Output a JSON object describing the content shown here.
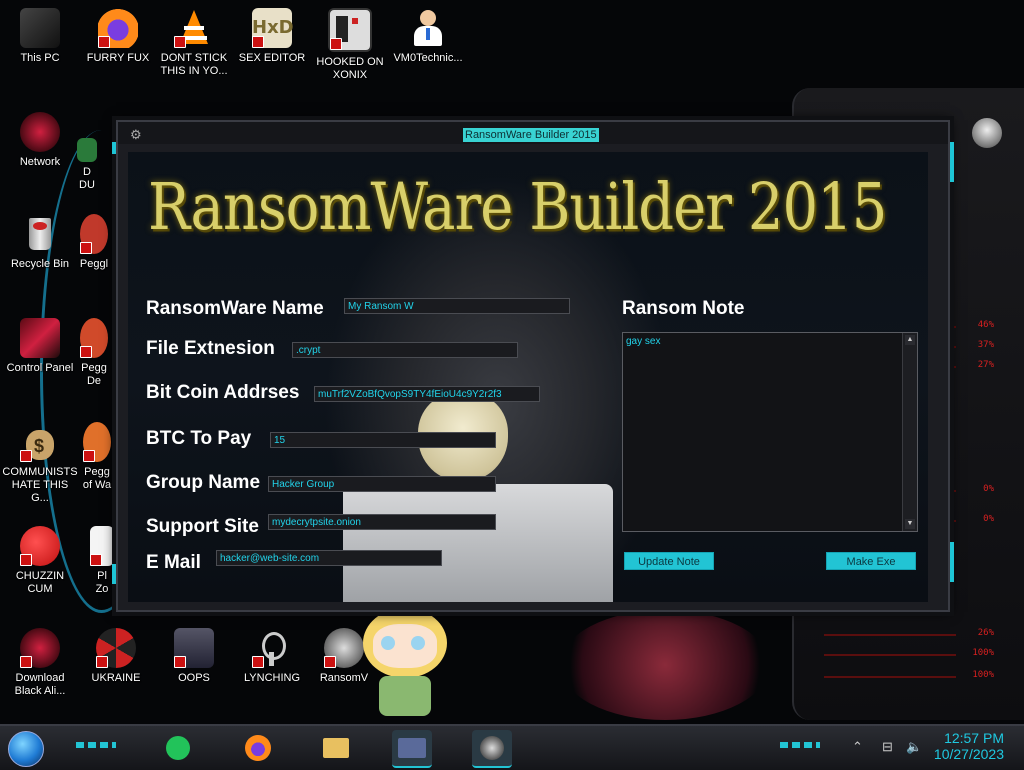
{
  "desktop": {
    "icons": [
      {
        "label": "This PC"
      },
      {
        "label": "FURRY FUX"
      },
      {
        "label": "DONT STICK\nTHIS IN YO..."
      },
      {
        "label": "SEX EDITOR"
      },
      {
        "label": "HOOKED ON\nXONIX"
      },
      {
        "label": "VM0Technic..."
      },
      {
        "label": "Network"
      },
      {
        "label": "D\nDU"
      },
      {
        "label": "Recycle Bin"
      },
      {
        "label": "Peggl"
      },
      {
        "label": "Control Panel"
      },
      {
        "label": "Pegg\nDe"
      },
      {
        "label": "COMMUNISTS\nHATE THIS G..."
      },
      {
        "label": "Pegg\nof Wa"
      },
      {
        "label": "CHUZZIN\nCUM"
      },
      {
        "label": "Pl\nZo"
      },
      {
        "label": "Download\nBlack Ali..."
      },
      {
        "label": "UKRAINE"
      },
      {
        "label": "OOPS"
      },
      {
        "label": "LYNCHING"
      },
      {
        "label": "RansomV"
      }
    ]
  },
  "app": {
    "window_title": "RansomWare Builder 2015",
    "logo_text": "RansomWare Builder 2015",
    "fields": {
      "ransomware_name": {
        "label": "RansomWare Name",
        "value": "My Ransom W"
      },
      "file_extension": {
        "label": "File Extnesion",
        "value": ".crypt"
      },
      "bitcoin_address": {
        "label": "Bit Coin Addrses",
        "value": "muTrf2VZoBfQvopS9TY4fEioU4c9Y2r2f3"
      },
      "btc_to_pay": {
        "label": "BTC To Pay",
        "value": "15"
      },
      "group_name": {
        "label": "Group Name",
        "value": "Hacker Group"
      },
      "support_site": {
        "label": "Support Site",
        "value": "mydecrytpsite.onion"
      },
      "email": {
        "label": "E Mail",
        "value": "hacker@web-site.com"
      }
    },
    "ransom_note": {
      "label": "Ransom Note",
      "value": "gay sex"
    },
    "buttons": {
      "update_note": "Update Note",
      "make_exe": "Make Exe"
    }
  },
  "hud": {
    "readings": [
      "46%",
      "37%",
      "27%",
      "0%",
      "0%",
      "26%",
      "100%",
      "100%"
    ]
  },
  "taskbar": {
    "time": "12:57 PM",
    "date": "10/27/2023"
  },
  "colors": {
    "accent": "#22c4d4",
    "logo_gold": "#d8cf6a",
    "input_text": "#22d3ea",
    "hud_red": "#d62020"
  }
}
